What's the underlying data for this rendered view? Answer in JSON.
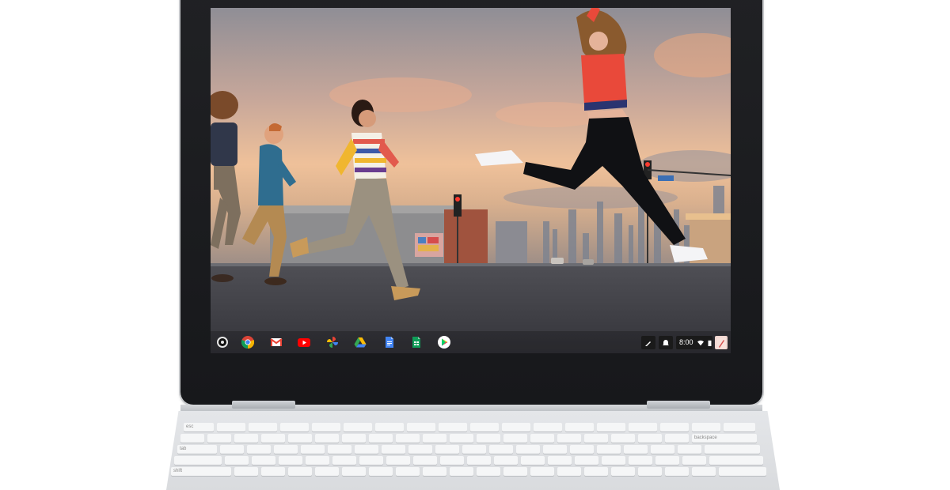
{
  "wallpaper": {
    "subject": "people-running-across-street-at-sunset"
  },
  "shelf": {
    "apps": [
      {
        "name": "chrome-icon",
        "color": "#4285F4"
      },
      {
        "name": "gmail-icon",
        "color": "#EA4335"
      },
      {
        "name": "youtube-icon",
        "color": "#FF0000"
      },
      {
        "name": "photos-icon",
        "color": "#FBBC05"
      },
      {
        "name": "drive-icon",
        "color": "#34A853"
      },
      {
        "name": "docs-icon",
        "color": "#4285F4"
      },
      {
        "name": "sheets-icon",
        "color": "#0F9D58"
      },
      {
        "name": "play-store-icon",
        "color": "#00C4FF"
      }
    ],
    "status_time": "8:00"
  },
  "keyboard": {
    "key_labels": {
      "esc": "esc",
      "backspace": "backspace",
      "tab": "tab",
      "shift": "shift"
    }
  }
}
